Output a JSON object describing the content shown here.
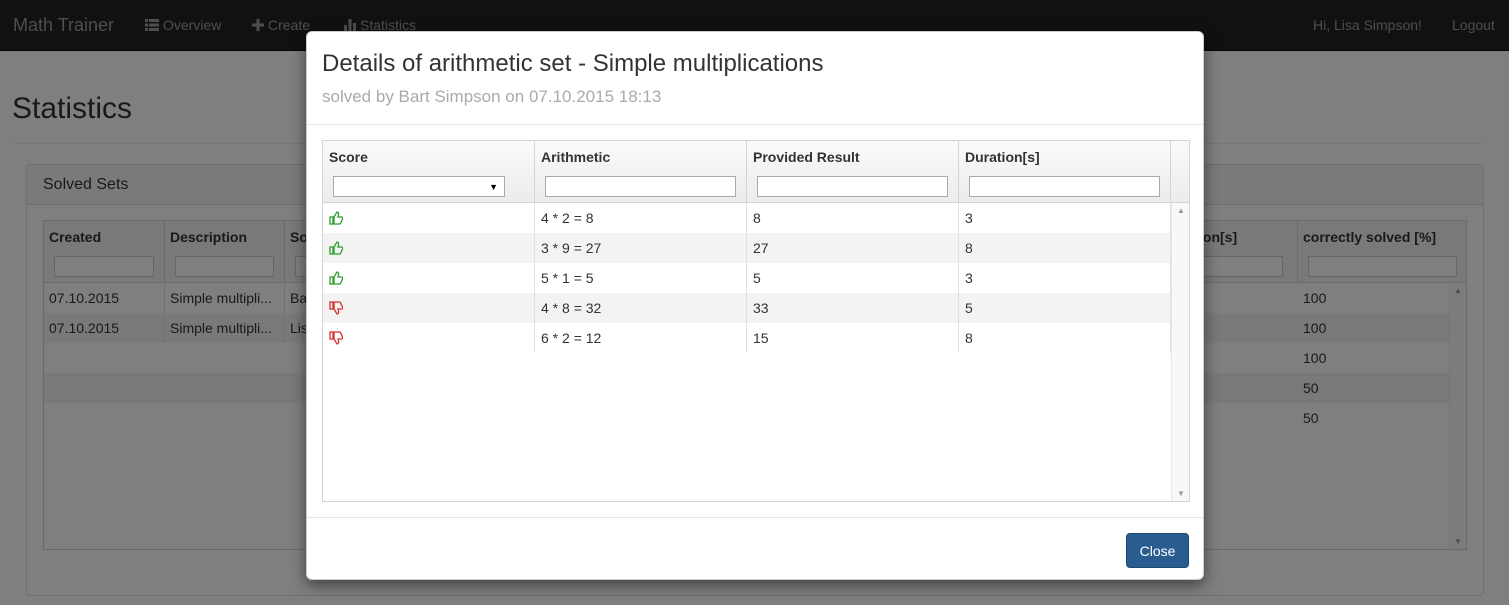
{
  "navbar": {
    "brand": "Math Trainer",
    "links": [
      "Overview",
      "Create",
      "Statistics"
    ],
    "greeting": "Hi, Lisa Simpson!",
    "logout": "Logout"
  },
  "page": {
    "title": "Statistics",
    "panel_title": "Solved Sets",
    "columns": [
      "Created",
      "Description",
      "So",
      "ion[s]",
      "correctly solved [%]"
    ],
    "rows": [
      {
        "created": "07.10.2015",
        "description": "Simple multipli...",
        "solver": "Ba",
        "correct": "100"
      },
      {
        "created": "07.10.2015",
        "description": "Simple multipli...",
        "solver": "Lis",
        "correct": "100"
      }
    ],
    "extra_correct": [
      "100",
      "50",
      "50"
    ]
  },
  "modal": {
    "title": "Details of arithmetic set - Simple multiplications",
    "subtitle": "solved by Bart Simpson on 07.10.2015 18:13",
    "columns": [
      "Score",
      "Arithmetic",
      "Provided Result",
      "Duration[s]"
    ],
    "rows": [
      {
        "score": "correct",
        "arithmetic": "4 * 2 = 8",
        "result": "8",
        "duration": "3"
      },
      {
        "score": "correct",
        "arithmetic": "3 * 9 = 27",
        "result": "27",
        "duration": "8"
      },
      {
        "score": "correct",
        "arithmetic": "5 * 1 = 5",
        "result": "5",
        "duration": "3"
      },
      {
        "score": "wrong",
        "arithmetic": "4 * 8 = 32",
        "result": "33",
        "duration": "5"
      },
      {
        "score": "wrong",
        "arithmetic": "6 * 2 = 12",
        "result": "15",
        "duration": "8"
      }
    ],
    "close_label": "Close",
    "colors": {
      "correct": "#2a9d2a",
      "wrong": "#d9302c",
      "close_button": "#295c8f"
    },
    "icons": {
      "correct": "thumbs-up-icon",
      "wrong": "thumbs-down-icon"
    }
  }
}
